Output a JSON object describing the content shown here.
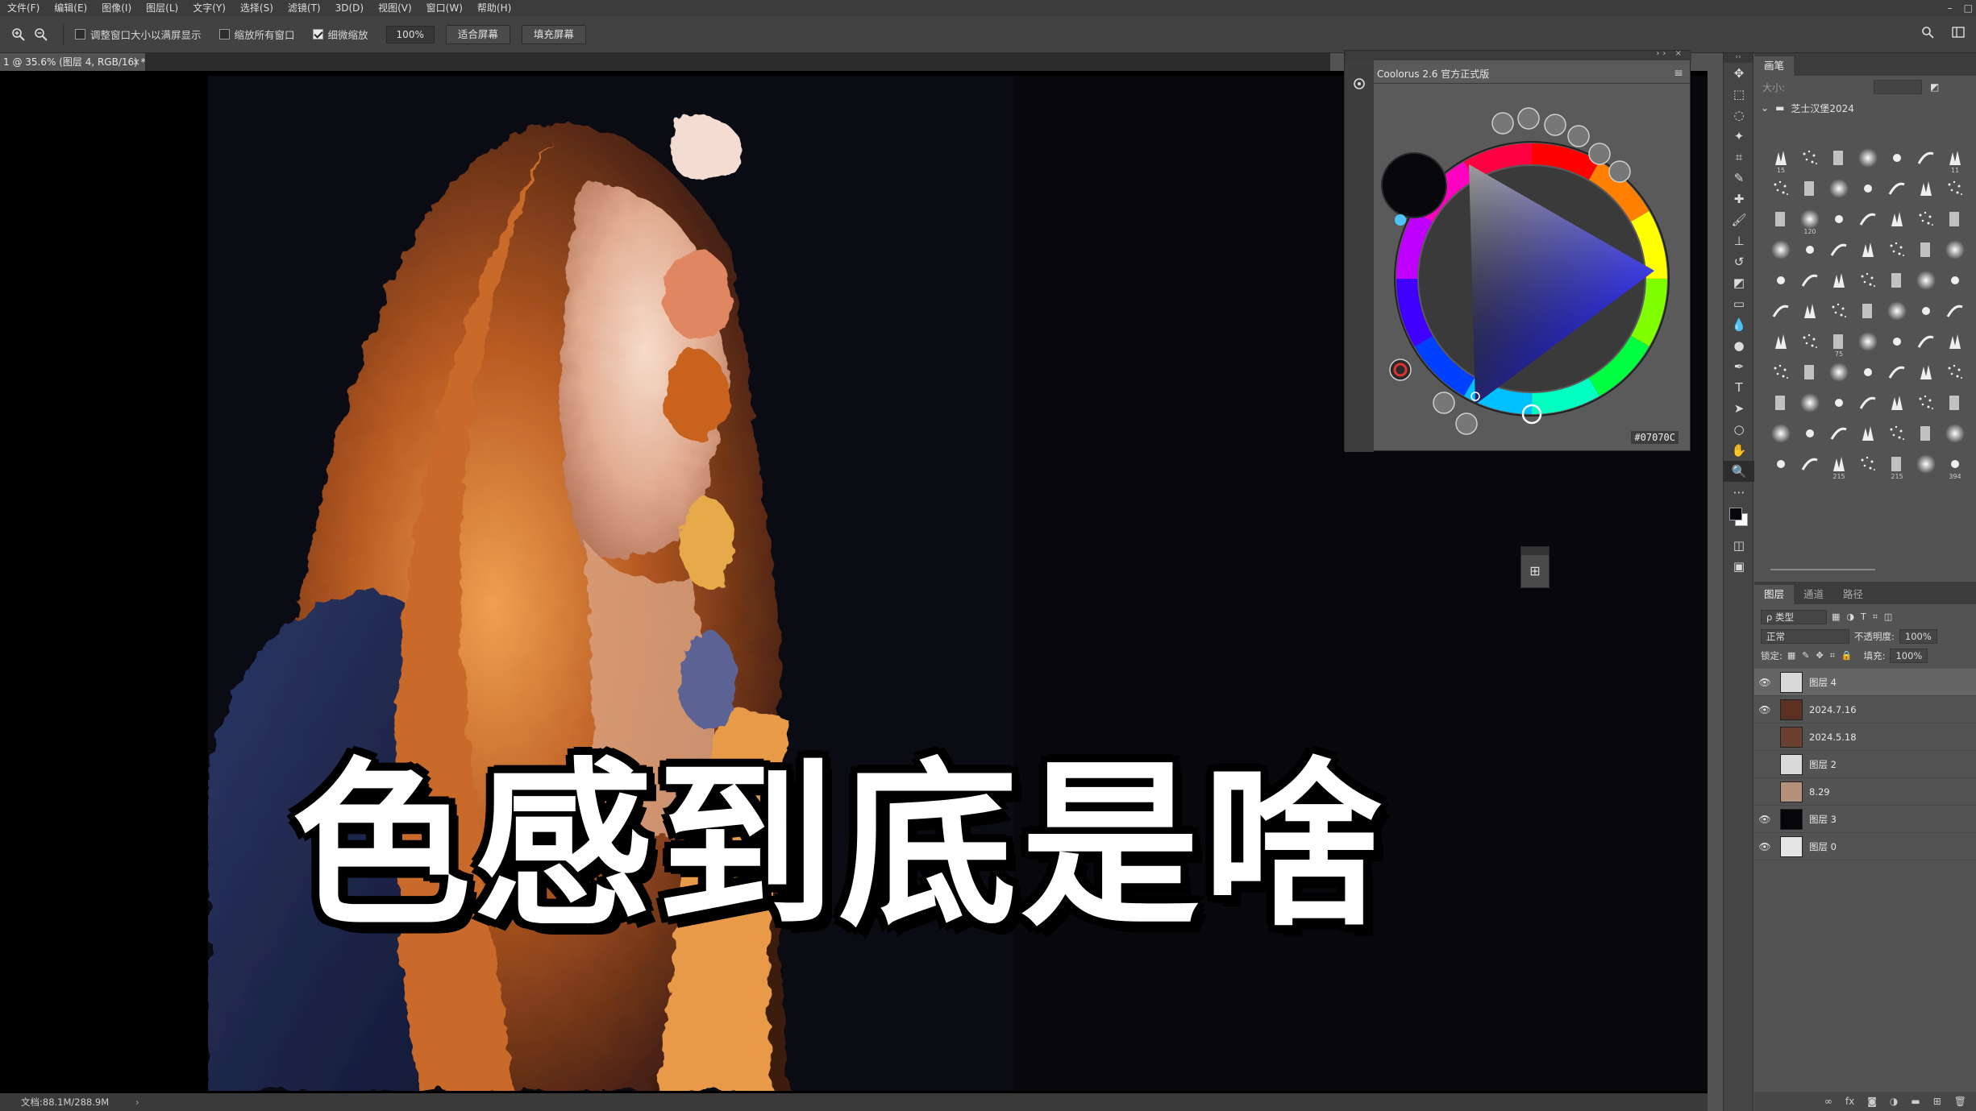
{
  "menu": {
    "items": [
      "文件(F)",
      "编辑(E)",
      "图像(I)",
      "图层(L)",
      "文字(Y)",
      "选择(S)",
      "滤镜(T)",
      "3D(D)",
      "视图(V)",
      "窗口(W)",
      "帮助(H)"
    ],
    "window_controls": [
      "–",
      "□"
    ]
  },
  "options": {
    "resize_windows_label": "调整窗口大小以满屏显示",
    "zoom_all_label": "缩放所有窗口",
    "scrubby_zoom_label": "细微缩放",
    "zoom_value": "100%",
    "fit_screen_label": "适合屏幕",
    "fill_screen_label": "填充屏幕",
    "resize_windows_checked": false,
    "zoom_all_checked": false,
    "scrubby_zoom_checked": true
  },
  "document": {
    "tab_title": "1 @ 35.6% (图层 4, RGB/16) *",
    "status_text": "文档:88.1M/288.9M"
  },
  "overlay": {
    "title": "色感到底是啥"
  },
  "coolorus": {
    "title": "Coolorus 2.6 官方正式版",
    "hex": "#07070C",
    "foreground_color": "#07070C",
    "background_color": "#FFFFFF"
  },
  "brushes": {
    "tab": "画笔",
    "size_label": "大小:",
    "group_name": "芝士汉堡2024",
    "cells": [
      {
        "num": "15"
      },
      {
        "num": ""
      },
      {
        "num": ""
      },
      {
        "num": ""
      },
      {
        "num": ""
      },
      {
        "num": ""
      },
      {
        "num": "11"
      },
      {
        "num": ""
      },
      {
        "num": ""
      },
      {
        "num": ""
      },
      {
        "num": ""
      },
      {
        "num": ""
      },
      {
        "num": ""
      },
      {
        "num": ""
      },
      {
        "num": ""
      },
      {
        "num": "120"
      },
      {
        "num": ""
      },
      {
        "num": ""
      },
      {
        "num": ""
      },
      {
        "num": ""
      },
      {
        "num": ""
      },
      {
        "num": ""
      },
      {
        "num": ""
      },
      {
        "num": ""
      },
      {
        "num": ""
      },
      {
        "num": ""
      },
      {
        "num": ""
      },
      {
        "num": ""
      },
      {
        "num": ""
      },
      {
        "num": ""
      },
      {
        "num": ""
      },
      {
        "num": ""
      },
      {
        "num": ""
      },
      {
        "num": ""
      },
      {
        "num": ""
      },
      {
        "num": ""
      },
      {
        "num": ""
      },
      {
        "num": ""
      },
      {
        "num": ""
      },
      {
        "num": ""
      },
      {
        "num": ""
      },
      {
        "num": ""
      },
      {
        "num": ""
      },
      {
        "num": ""
      },
      {
        "num": "75"
      },
      {
        "num": ""
      },
      {
        "num": ""
      },
      {
        "num": ""
      },
      {
        "num": ""
      },
      {
        "num": ""
      },
      {
        "num": ""
      },
      {
        "num": ""
      },
      {
        "num": ""
      },
      {
        "num": ""
      },
      {
        "num": ""
      },
      {
        "num": ""
      },
      {
        "num": ""
      },
      {
        "num": ""
      },
      {
        "num": ""
      },
      {
        "num": ""
      },
      {
        "num": ""
      },
      {
        "num": ""
      },
      {
        "num": ""
      },
      {
        "num": ""
      },
      {
        "num": ""
      },
      {
        "num": ""
      },
      {
        "num": ""
      },
      {
        "num": ""
      },
      {
        "num": ""
      },
      {
        "num": ""
      },
      {
        "num": ""
      },
      {
        "num": ""
      },
      {
        "num": "215"
      },
      {
        "num": ""
      },
      {
        "num": "215"
      },
      {
        "num": ""
      },
      {
        "num": "394"
      }
    ]
  },
  "layers_panel": {
    "tabs": [
      "图层",
      "通道",
      "路径"
    ],
    "filter_label": "ρ 类型",
    "blend_mode": "正常",
    "opacity_label": "不透明度:",
    "opacity_value": "100%",
    "lock_label": "锁定:",
    "fill_label": "填充:",
    "fill_value": "100%",
    "layers": [
      {
        "name": "图层 4",
        "visible": true,
        "selected": true,
        "thumb": "#d9d9d9"
      },
      {
        "name": "2024.7.16",
        "visible": true,
        "selected": false,
        "thumb": "#5a3022"
      },
      {
        "name": "2024.5.18",
        "visible": false,
        "selected": false,
        "thumb": "#6a4030"
      },
      {
        "name": "图层 2",
        "visible": false,
        "selected": false,
        "thumb": "#d9d9d9"
      },
      {
        "name": "8.29",
        "visible": false,
        "selected": false,
        "thumb": "#b5907a"
      },
      {
        "name": "图层 3",
        "visible": true,
        "selected": false,
        "thumb": "#06060a"
      },
      {
        "name": "图层 0",
        "visible": true,
        "selected": false,
        "thumb": "#e4e4e4"
      }
    ],
    "footer_icons": [
      "link-icon",
      "fx-icon",
      "mask-icon",
      "adjustment-icon",
      "folder-icon",
      "new-layer-icon",
      "trash-icon"
    ]
  }
}
